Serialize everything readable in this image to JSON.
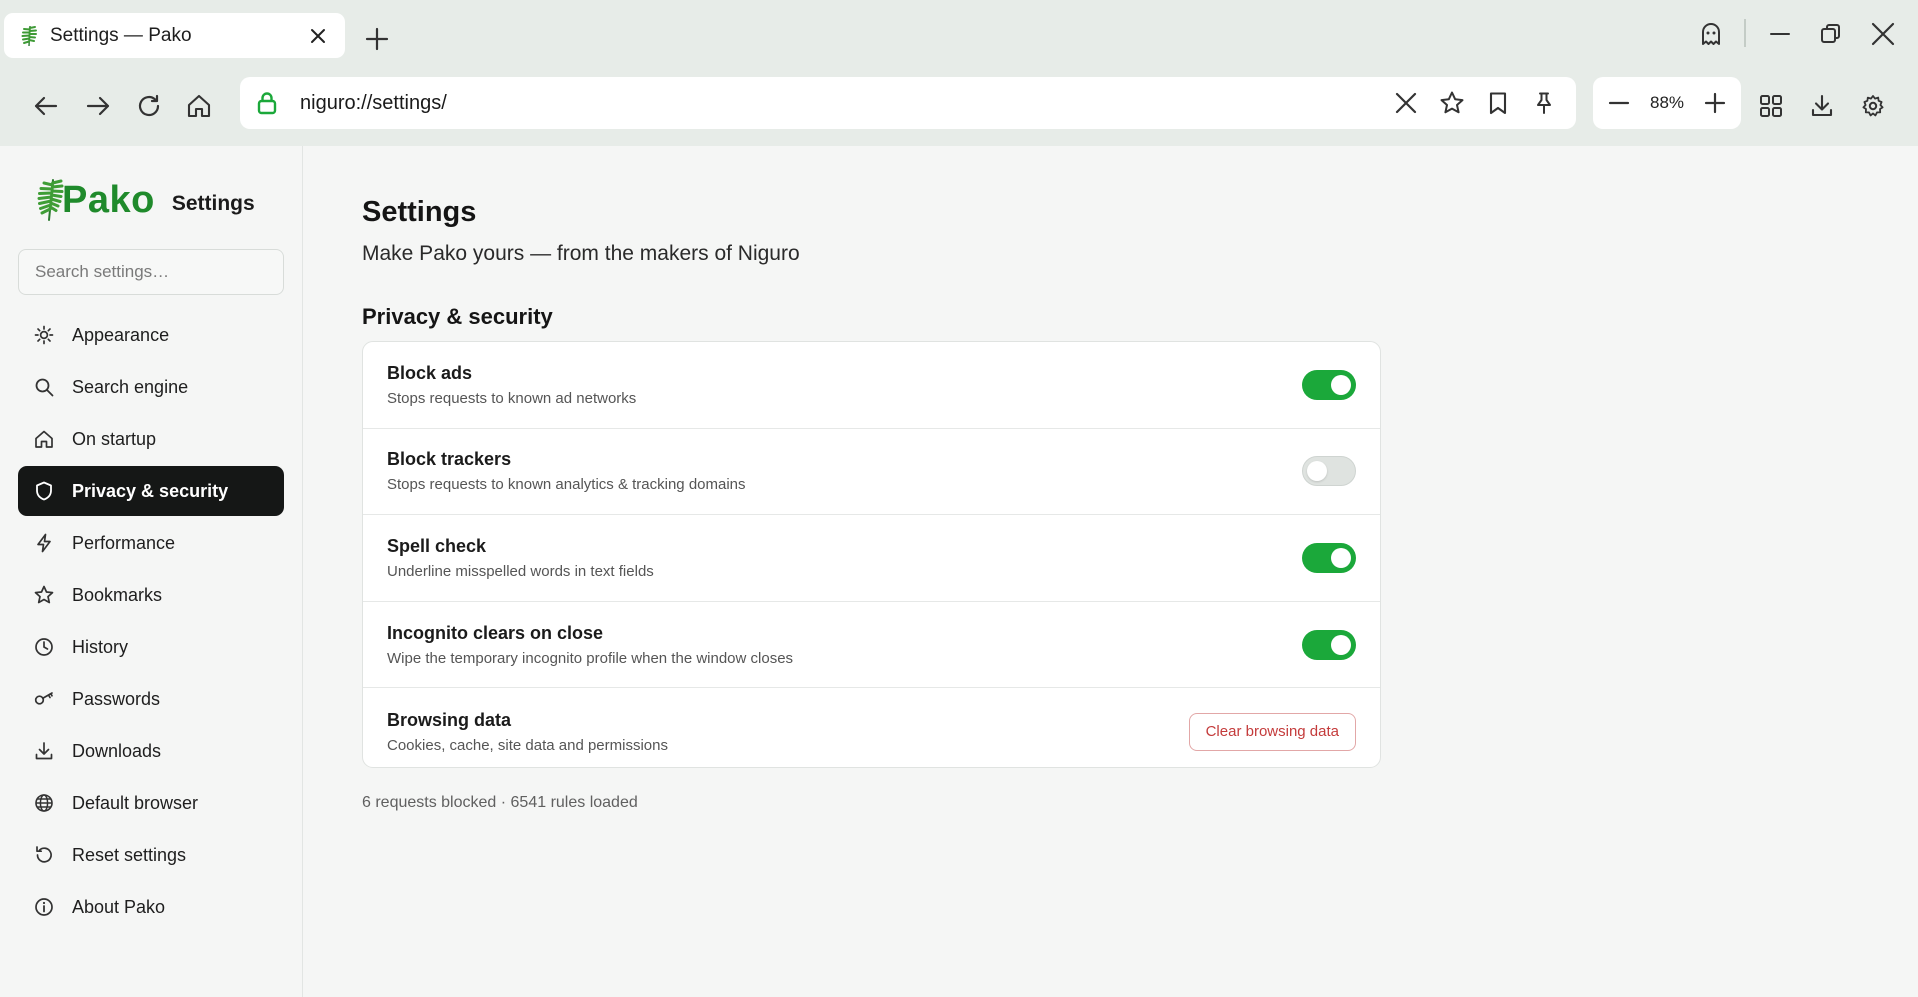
{
  "colors": {
    "accent_green": "#1ba83a",
    "brand_green": "#1f8a2b",
    "active_nav_bg": "#151716",
    "danger": "#c43b3b"
  },
  "tab": {
    "title": "Settings — Pako",
    "favicon": "fern-icon"
  },
  "toolbar": {
    "url": "niguro://settings/",
    "zoom": "88%"
  },
  "sidebar": {
    "brand": "Pako",
    "brand_sub": "Settings",
    "search_placeholder": "Search settings…",
    "items": [
      {
        "label": "Appearance",
        "icon": "sun-icon"
      },
      {
        "label": "Search engine",
        "icon": "search-icon"
      },
      {
        "label": "On startup",
        "icon": "home-icon"
      },
      {
        "label": "Privacy & security",
        "icon": "shield-icon",
        "active": true
      },
      {
        "label": "Performance",
        "icon": "lightning-icon"
      },
      {
        "label": "Bookmarks",
        "icon": "star-icon"
      },
      {
        "label": "History",
        "icon": "clock-icon"
      },
      {
        "label": "Passwords",
        "icon": "key-icon"
      },
      {
        "label": "Downloads",
        "icon": "download-icon"
      },
      {
        "label": "Default browser",
        "icon": "globe-icon"
      },
      {
        "label": "Reset settings",
        "icon": "reset-icon"
      },
      {
        "label": "About Pako",
        "icon": "info-icon"
      }
    ]
  },
  "main": {
    "title": "Settings",
    "subtitle": "Make Pako yours — from the makers of Niguro",
    "section_title": "Privacy & security",
    "rows": [
      {
        "label": "Block ads",
        "desc": "Stops requests to known ad networks",
        "enabled": true
      },
      {
        "label": "Block trackers",
        "desc": "Stops requests to known analytics & tracking domains",
        "enabled": false
      },
      {
        "label": "Spell check",
        "desc": "Underline misspelled words in text fields",
        "enabled": true
      },
      {
        "label": "Incognito clears on close",
        "desc": "Wipe the temporary incognito profile when the window closes",
        "enabled": true
      },
      {
        "label": "Browsing data",
        "desc": "Cookies, cache, site data and permissions",
        "button": "Clear browsing data"
      }
    ],
    "footer": "6 requests blocked · 6541 rules loaded"
  }
}
